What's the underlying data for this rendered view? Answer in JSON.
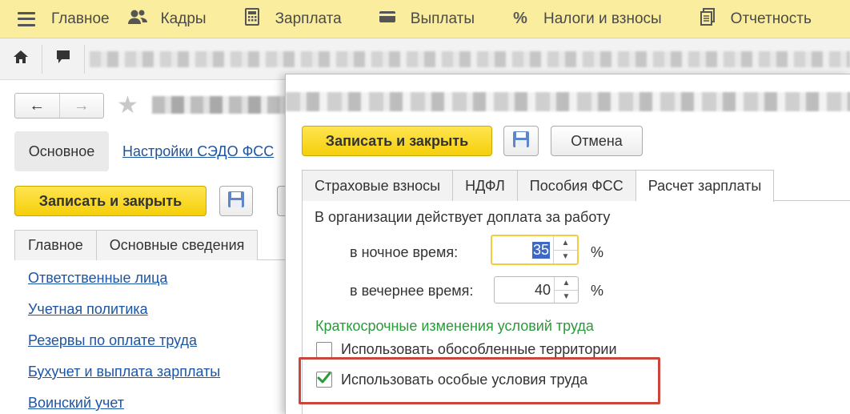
{
  "top_menu": [
    {
      "label": "Главное",
      "icon": "menu-icon"
    },
    {
      "label": "Кадры",
      "icon": "people-icon"
    },
    {
      "label": "Зарплата",
      "icon": "calculator-icon"
    },
    {
      "label": "Выплаты",
      "icon": "card-icon"
    },
    {
      "label": "Налоги и взносы",
      "icon": "percent-icon"
    },
    {
      "label": "Отчетность",
      "icon": "report-icon"
    }
  ],
  "navbar": {
    "home_icon": "home-icon",
    "chat_icon": "chat-icon"
  },
  "background_form": {
    "tab_main": "Основное",
    "link_sedo": "Настройки СЭДО ФСС",
    "save_close": "Записать и закрыть",
    "tabs": [
      "Главное",
      "Основные сведения"
    ],
    "links": [
      "Ответственные лица",
      "Учетная политика",
      "Резервы по оплате труда",
      "Бухучет и выплата зарплаты",
      "Воинский учет"
    ]
  },
  "modal": {
    "save_close": "Записать и закрыть",
    "cancel": "Отмена",
    "tabs": [
      "Страховые взносы",
      "НДФЛ",
      "Пособия ФСС",
      "Расчет зарплаты"
    ],
    "active_tab": "Расчет зарплаты",
    "surcharge_label": "В организации действует доплата за работу",
    "night_label": "в ночное время:",
    "night_value": "35",
    "evening_label": "в вечернее время:",
    "evening_value": "40",
    "percent": "%",
    "section_title": "Краткосрочные изменения условий труда",
    "checkbox_territories": {
      "label": "Использовать обособленные территории",
      "checked": false
    },
    "checkbox_special": {
      "label": "Использовать особые условия труда",
      "checked": true
    }
  },
  "colors": {
    "menu_bg": "#fbed9e",
    "accent_yellow": "#f5cf0a",
    "link": "#1c55a3",
    "green": "#2b9a3a",
    "highlight": "#c9463d"
  }
}
